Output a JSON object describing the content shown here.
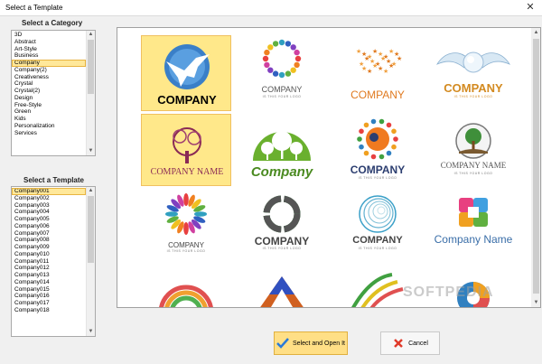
{
  "window": {
    "title": "Select a Template",
    "close_glyph": "✕"
  },
  "category_panel": {
    "title": "Select a Category",
    "items": [
      "3D",
      "Abstract",
      "Art-Style",
      "Business",
      "Company",
      "Company(2)",
      "Creativeness",
      "Crystal",
      "Crystal(2)",
      "Design",
      "Free-Style",
      "Green",
      "Kids",
      "Personalization",
      "Services"
    ],
    "selected": "Company"
  },
  "template_panel": {
    "title": "Select a Template",
    "items": [
      "Company001",
      "Company002",
      "Company003",
      "Company004",
      "Company005",
      "Company006",
      "Company007",
      "Company008",
      "Company009",
      "Company010",
      "Company011",
      "Company012",
      "Company013",
      "Company014",
      "Company015",
      "Company016",
      "Company017",
      "Company018"
    ],
    "selected": "Company001"
  },
  "gallery": {
    "tiles": [
      {
        "name": "Company001",
        "text": "COMPANY",
        "slogan": "",
        "color": "#2e6db4"
      },
      {
        "name": "Company002",
        "text": "COMPANY",
        "slogan": "IS THIS YOUR LOGO",
        "color": "#555555"
      },
      {
        "name": "Company003",
        "text": "COMPANY",
        "slogan": "",
        "color": "#e07a20"
      },
      {
        "name": "Company004",
        "text": "COMPANY",
        "slogan": "IS THIS YOUR LOGO",
        "color": "#d38a20"
      },
      {
        "name": "Company005",
        "text": "COMPANY NAME",
        "slogan": "",
        "color": "#8a2a55"
      },
      {
        "name": "Company006",
        "text": "Company",
        "slogan": "",
        "color": "#4a8a20"
      },
      {
        "name": "Company007",
        "text": "COMPANY",
        "slogan": "IS THIS YOUR LOGO",
        "color": "#2c3e70"
      },
      {
        "name": "Company008",
        "text": "COMPANY NAME",
        "slogan": "IS THIS YOUR LOGO",
        "color": "#555555"
      },
      {
        "name": "Company009",
        "text": "COMPANY",
        "slogan": "IS THIS YOUR LOGO",
        "color": "#444444"
      },
      {
        "name": "Company010",
        "text": "COMPANY",
        "slogan": "IS THIS YOUR LOGO",
        "color": "#444444"
      },
      {
        "name": "Company011",
        "text": "COMPANY",
        "slogan": "IS THIS YOUR LOGO",
        "color": "#444444"
      },
      {
        "name": "Company012",
        "text": "Company Name",
        "slogan": "",
        "color": "#3a6ea8"
      },
      {
        "name": "Company013",
        "text": "",
        "slogan": "",
        "color": "#e05050"
      },
      {
        "name": "Company014",
        "text": "",
        "slogan": "",
        "color": "#d06020"
      },
      {
        "name": "Company015",
        "text": "",
        "slogan": "",
        "color": "#40a040"
      },
      {
        "name": "Company016",
        "text": "",
        "slogan": "",
        "color": "#3080c0"
      }
    ],
    "selected": "Company001",
    "watermark": "SOFTPEDIA"
  },
  "buttons": {
    "select_open": "Select and Open It",
    "cancel": "Cancel"
  }
}
